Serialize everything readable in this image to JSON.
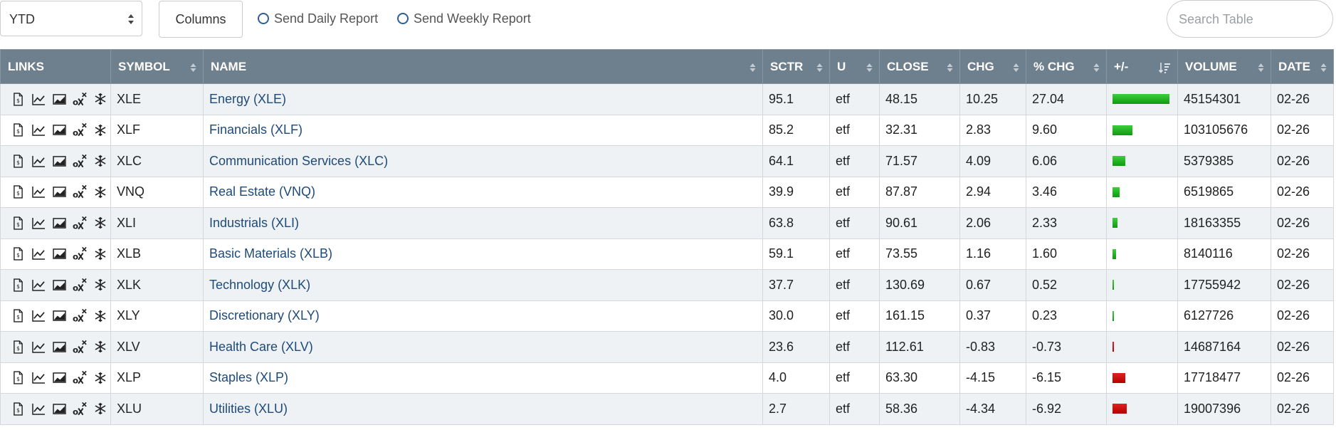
{
  "controls": {
    "period_value": "YTD",
    "columns_label": "Columns",
    "daily_report_label": "Send Daily Report",
    "weekly_report_label": "Send Weekly Report",
    "search_placeholder": "Search Table"
  },
  "columns": [
    "LINKS",
    "SYMBOL",
    "NAME",
    "SCTR",
    "U",
    "CLOSE",
    "CHG",
    "% CHG",
    "+/-",
    "VOLUME",
    "DATE"
  ],
  "link_icons": [
    "document-icon",
    "line-chart-icon",
    "image-chart-icon",
    "option-chain-icon",
    "seasonality-icon"
  ],
  "colors": {
    "header_bg": "#6e7f8d",
    "link": "#1e4a7a",
    "positive": "#1fbf1f",
    "negative": "#d10000"
  },
  "rows": [
    {
      "symbol": "XLE",
      "name": "Energy (XLE)",
      "sctr": "95.1",
      "u": "etf",
      "close": "48.15",
      "chg": "10.25",
      "pct_chg": "27.04",
      "pct_value": 27.04,
      "volume": "45154301",
      "date": "02-26"
    },
    {
      "symbol": "XLF",
      "name": "Financials (XLF)",
      "sctr": "85.2",
      "u": "etf",
      "close": "32.31",
      "chg": "2.83",
      "pct_chg": "9.60",
      "pct_value": 9.6,
      "volume": "103105676",
      "date": "02-26"
    },
    {
      "symbol": "XLC",
      "name": "Communication Services (XLC)",
      "sctr": "64.1",
      "u": "etf",
      "close": "71.57",
      "chg": "4.09",
      "pct_chg": "6.06",
      "pct_value": 6.06,
      "volume": "5379385",
      "date": "02-26"
    },
    {
      "symbol": "VNQ",
      "name": "Real Estate (VNQ)",
      "sctr": "39.9",
      "u": "etf",
      "close": "87.87",
      "chg": "2.94",
      "pct_chg": "3.46",
      "pct_value": 3.46,
      "volume": "6519865",
      "date": "02-26"
    },
    {
      "symbol": "XLI",
      "name": "Industrials (XLI)",
      "sctr": "63.8",
      "u": "etf",
      "close": "90.61",
      "chg": "2.06",
      "pct_chg": "2.33",
      "pct_value": 2.33,
      "volume": "18163355",
      "date": "02-26"
    },
    {
      "symbol": "XLB",
      "name": "Basic Materials (XLB)",
      "sctr": "59.1",
      "u": "etf",
      "close": "73.55",
      "chg": "1.16",
      "pct_chg": "1.60",
      "pct_value": 1.6,
      "volume": "8140116",
      "date": "02-26"
    },
    {
      "symbol": "XLK",
      "name": "Technology (XLK)",
      "sctr": "37.7",
      "u": "etf",
      "close": "130.69",
      "chg": "0.67",
      "pct_chg": "0.52",
      "pct_value": 0.52,
      "volume": "17755942",
      "date": "02-26"
    },
    {
      "symbol": "XLY",
      "name": "Discretionary (XLY)",
      "sctr": "30.0",
      "u": "etf",
      "close": "161.15",
      "chg": "0.37",
      "pct_chg": "0.23",
      "pct_value": 0.23,
      "volume": "6127726",
      "date": "02-26"
    },
    {
      "symbol": "XLV",
      "name": "Health Care (XLV)",
      "sctr": "23.6",
      "u": "etf",
      "close": "112.61",
      "chg": "-0.83",
      "pct_chg": "-0.73",
      "pct_value": -0.73,
      "volume": "14687164",
      "date": "02-26"
    },
    {
      "symbol": "XLP",
      "name": "Staples (XLP)",
      "sctr": "4.0",
      "u": "etf",
      "close": "63.30",
      "chg": "-4.15",
      "pct_chg": "-6.15",
      "pct_value": -6.15,
      "volume": "17718477",
      "date": "02-26"
    },
    {
      "symbol": "XLU",
      "name": "Utilities (XLU)",
      "sctr": "2.7",
      "u": "etf",
      "close": "58.36",
      "chg": "-4.34",
      "pct_chg": "-6.92",
      "pct_value": -6.92,
      "volume": "19007396",
      "date": "02-26"
    }
  ]
}
